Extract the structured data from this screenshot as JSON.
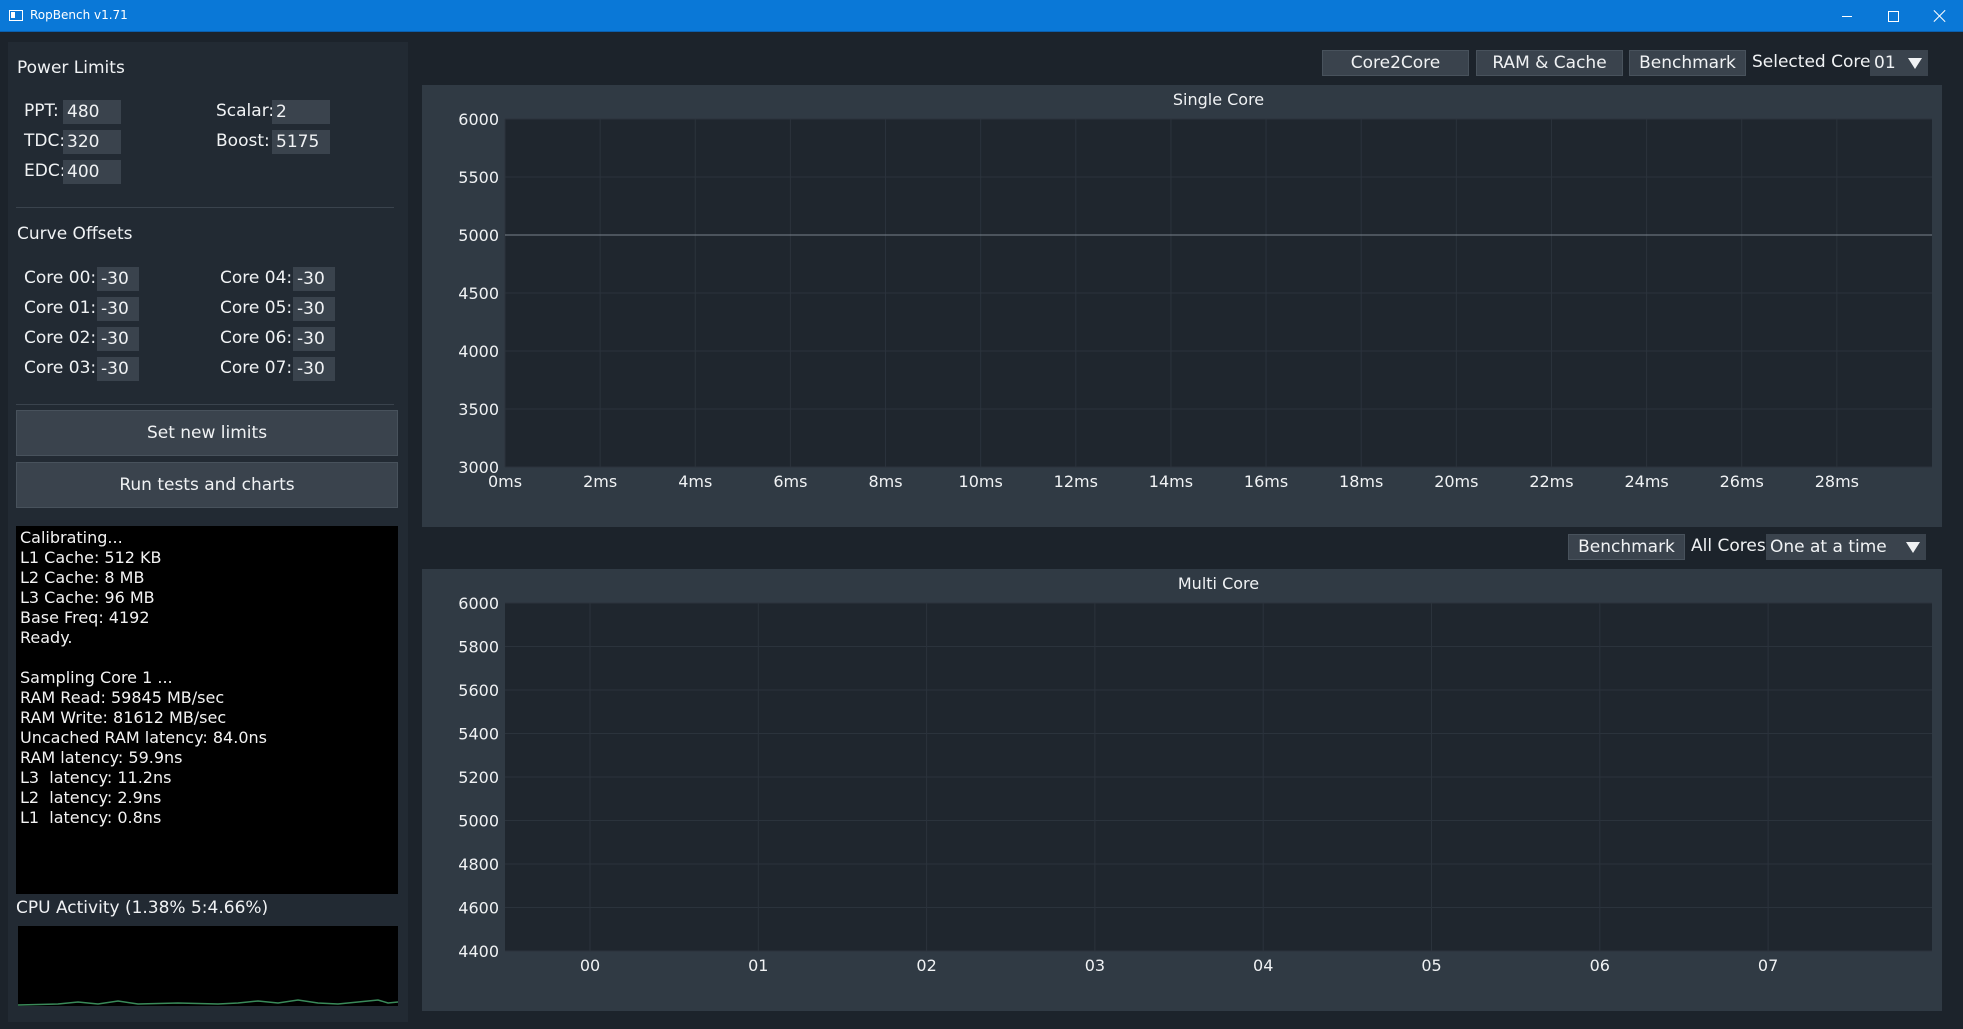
{
  "window": {
    "title": "RopBench v1.71",
    "icon": "app-window-icon"
  },
  "power_limits": {
    "title": "Power Limits",
    "ppt_label": "PPT:",
    "ppt_value": "480",
    "tdc_label": "TDC:",
    "tdc_value": "320",
    "edc_label": "EDC:",
    "edc_value": "400",
    "scalar_label": "Scalar:",
    "scalar_value": "2",
    "boost_label": "Boost:",
    "boost_value": "5175"
  },
  "curve_offsets": {
    "title": "Curve Offsets",
    "cores": [
      {
        "label": "Core 00:",
        "value": "-30"
      },
      {
        "label": "Core 01:",
        "value": "-30"
      },
      {
        "label": "Core 02:",
        "value": "-30"
      },
      {
        "label": "Core 03:",
        "value": "-30"
      },
      {
        "label": "Core 04:",
        "value": "-30"
      },
      {
        "label": "Core 05:",
        "value": "-30"
      },
      {
        "label": "Core 06:",
        "value": "-30"
      },
      {
        "label": "Core 07:",
        "value": "-30"
      }
    ]
  },
  "actions": {
    "set_limits": "Set new limits",
    "run_tests": "Run tests and charts"
  },
  "console_lines": [
    "Calibrating...",
    "L1 Cache: 512 KB",
    "L2 Cache: 8 MB",
    "L3 Cache: 96 MB",
    "Base Freq: 4192",
    "Ready.",
    "",
    "Sampling Core 1 ...",
    "RAM Read: 59845 MB/sec",
    "RAM Write: 81612 MB/sec",
    "Uncached RAM latency: 84.0ns",
    "RAM latency: 59.9ns",
    "L3  latency: 11.2ns",
    "L2  latency: 2.9ns",
    "L1  latency: 0.8ns"
  ],
  "cpu_activity": {
    "label": "CPU Activity (1.38% 5:4.66%)",
    "line_color": "#3a8a5a"
  },
  "top_toolbar": {
    "core2core": "Core2Core",
    "ram_cache": "RAM & Cache",
    "benchmark": "Benchmark",
    "selected_core_label": "Selected Core",
    "selected_core_value": "01"
  },
  "multi_toolbar": {
    "benchmark": "Benchmark",
    "all_cores_label": "All Cores",
    "mode_value": "One at a time"
  },
  "chart_data": [
    {
      "type": "line",
      "title": "Single Core",
      "x_ticks": [
        "0ms",
        "2ms",
        "4ms",
        "6ms",
        "8ms",
        "10ms",
        "12ms",
        "14ms",
        "16ms",
        "18ms",
        "20ms",
        "22ms",
        "24ms",
        "26ms",
        "28ms"
      ],
      "x_range": [
        0,
        30
      ],
      "y_ticks": [
        "6000",
        "5500",
        "5000",
        "4500",
        "4000",
        "3500",
        "3000"
      ],
      "ylim": [
        3000,
        6000
      ],
      "series": [
        {
          "x": [
            0,
            30
          ],
          "y": [
            5000,
            5000
          ]
        }
      ],
      "grid": true
    },
    {
      "type": "bar",
      "title": "Multi Core",
      "categories": [
        "00",
        "01",
        "02",
        "03",
        "04",
        "05",
        "06",
        "07"
      ],
      "values": [],
      "y_ticks": [
        "6000",
        "5800",
        "5600",
        "5400",
        "5200",
        "5000",
        "4800",
        "4600",
        "4400"
      ],
      "ylim": [
        4400,
        6000
      ],
      "grid": true
    }
  ]
}
